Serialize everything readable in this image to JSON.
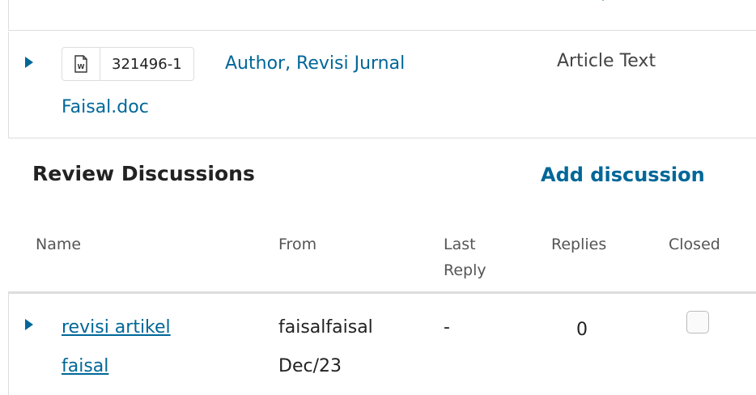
{
  "file": {
    "file_id": "321496-1",
    "file_name_line1": "Author, Revisi Jurnal",
    "file_name_line2": "Faisal.doc",
    "file_type": "Article Text",
    "icon": "word-document-icon"
  },
  "discussions": {
    "title": "Review Discussions",
    "add_label": "Add discussion",
    "columns": {
      "name": "Name",
      "from": "From",
      "last_reply_line1": "Last",
      "last_reply_line2": "Reply",
      "replies": "Replies",
      "closed": "Closed"
    },
    "rows": [
      {
        "name_line1": "revisi artikel",
        "name_line2": "faisal",
        "from_line1": "faisalfaisal",
        "from_line2": "Dec/23",
        "last_reply": "-",
        "replies": "0",
        "closed": false
      }
    ]
  },
  "colors": {
    "link": "#006798",
    "border": "#dddddd"
  }
}
